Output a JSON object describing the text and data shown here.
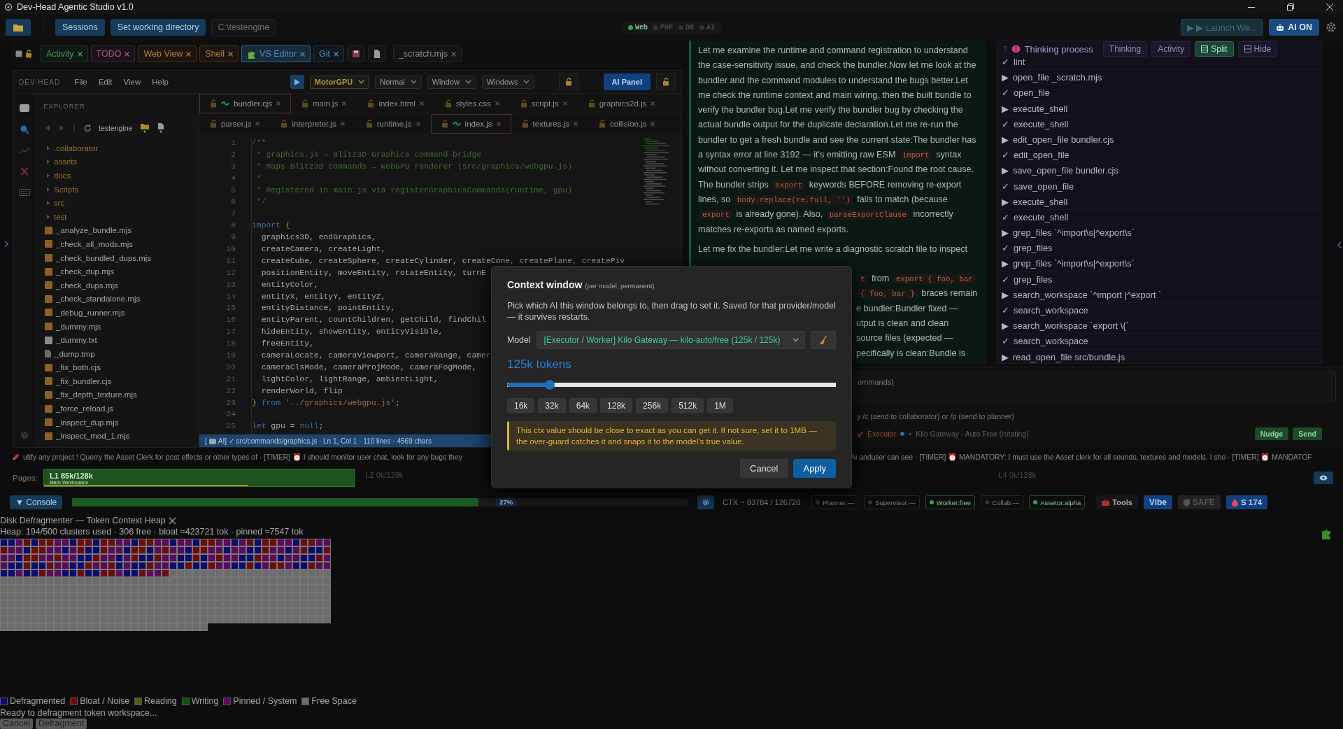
{
  "window": {
    "title": "Dev-Head Agentic Studio v1.0"
  },
  "toolbar": {
    "buttons": [
      "Sessions",
      "Set working directory"
    ],
    "path": "C:\\testengine",
    "services": [
      {
        "label": "Web",
        "on": true
      },
      {
        "label": "PHP",
        "on": false
      },
      {
        "label": "DB",
        "on": false
      },
      {
        "label": "AI",
        "on": false
      }
    ],
    "launch": "▶ ▶ Launch We...",
    "ai_toggle": {
      "label": "AI ON",
      "on": true
    }
  },
  "tab_strip": {
    "checked": false,
    "tabs": [
      {
        "label": "Activity",
        "color": "#3fa05a",
        "selected": false
      },
      {
        "label": "TODO",
        "color": "#b0508a",
        "selected": false
      },
      {
        "label": "Web View",
        "color": "#c07a30",
        "selected": false
      },
      {
        "label": "Shell",
        "color": "#c07a30",
        "selected": false
      },
      {
        "label": "VS Editor",
        "color": "#3f8fd0",
        "selected": true
      },
      {
        "label": "Git",
        "color": "#3f8fd0",
        "selected": false
      }
    ],
    "scratch": "_scratch.mjs"
  },
  "editor": {
    "brand": "DEV-HEAD",
    "menu": [
      "File",
      "Edit",
      "View",
      "Help"
    ],
    "selects": [
      {
        "value": "MotorGPU",
        "kind": "engine"
      },
      {
        "value": "Normal",
        "kind": "plain"
      },
      {
        "value": "Window",
        "kind": "plain"
      },
      {
        "value": "Windows",
        "kind": "plain"
      }
    ],
    "ai_panel": "AI Panel",
    "explorer": {
      "title": "EXPLORER",
      "root": "testengine",
      "items": [
        {
          "name": ".collaborator",
          "kind": "folder",
          "expanded": false
        },
        {
          "name": "assets",
          "kind": "folder",
          "expanded": false
        },
        {
          "name": "docs",
          "kind": "folder",
          "expanded": false
        },
        {
          "name": "Scripts",
          "kind": "folder",
          "expanded": false
        },
        {
          "name": "src",
          "kind": "folder",
          "expanded": false
        },
        {
          "name": "test",
          "kind": "folder",
          "expanded": false
        },
        {
          "name": "_analyze_bundle.mjs",
          "kind": "script"
        },
        {
          "name": "_check_all_mods.mjs",
          "kind": "script"
        },
        {
          "name": "_check_bundled_dups.mjs",
          "kind": "script"
        },
        {
          "name": "_check_dup.mjs",
          "kind": "script"
        },
        {
          "name": "_check_dups.mjs",
          "kind": "script"
        },
        {
          "name": "_check_standalone.mjs",
          "kind": "script"
        },
        {
          "name": "_debug_runner.mjs",
          "kind": "script"
        },
        {
          "name": "_dummy.mjs",
          "kind": "script"
        },
        {
          "name": "_dummy.txt",
          "kind": "text"
        },
        {
          "name": "_dump.tmp",
          "kind": "file"
        },
        {
          "name": "_fix_both.cjs",
          "kind": "script"
        },
        {
          "name": "_fix_bundler.cjs",
          "kind": "script"
        },
        {
          "name": "_fix_depth_texture.mjs",
          "kind": "script"
        },
        {
          "name": "_force_reload.js",
          "kind": "script"
        },
        {
          "name": "_inspect_dup.mjs",
          "kind": "script"
        },
        {
          "name": "_inspect_mod_1.mjs",
          "kind": "script"
        }
      ]
    },
    "file_tabs": [
      [
        {
          "name": "bundler.cjs",
          "modified": true
        },
        {
          "name": "main.js",
          "modified": false
        },
        {
          "name": "index.html",
          "modified": false
        },
        {
          "name": "styles.css",
          "modified": false
        },
        {
          "name": "script.js",
          "modified": false
        },
        {
          "name": "graphics2d.js",
          "modified": false
        }
      ],
      [
        {
          "name": "parser.js",
          "modified": false
        },
        {
          "name": "interpreter.js",
          "modified": false
        },
        {
          "name": "runtime.js",
          "modified": false
        },
        {
          "name": "index.js",
          "modified": true
        },
        {
          "name": "textures.js",
          "modified": false
        },
        {
          "name": "collision.js",
          "modified": false
        }
      ]
    ],
    "code_lines": [
      {
        "number": "1",
        "parts": [
          {
            "text": "/**",
            "kind": "comment"
          }
        ]
      },
      {
        "number": "2",
        "parts": [
          {
            "text": " * graphics.js — Blitz3D Graphics command bridge",
            "kind": "comment"
          }
        ]
      },
      {
        "number": "3",
        "parts": [
          {
            "text": " * Maps Blitz3D commands → WebGPU renderer (src/graphics/webgpu.js)",
            "kind": "comment"
          }
        ]
      },
      {
        "number": "4",
        "parts": [
          {
            "text": " *",
            "kind": "comment"
          }
        ]
      },
      {
        "number": "5",
        "parts": [
          {
            "text": " * Registered in main.js via registerGraphicsCommands(runtime, gpu)",
            "kind": "comment"
          }
        ]
      },
      {
        "number": "6",
        "parts": [
          {
            "text": " */",
            "kind": "comment"
          }
        ]
      },
      {
        "number": "7"
      },
      {
        "number": "8",
        "parts": [
          {
            "text": "import",
            "kind": "keyword"
          },
          {
            "text": " {",
            "kind": "brace"
          }
        ]
      },
      {
        "number": "9",
        "parts": [
          {
            "text": "  graphics3D, endGraphics,",
            "kind": "plain"
          }
        ]
      },
      {
        "number": "10",
        "parts": [
          {
            "text": "  createCamera, createLight,",
            "kind": "plain"
          }
        ]
      },
      {
        "number": "11",
        "parts": [
          {
            "text": "  createCube, createSphere, createCylinder, createCone, createPlane, createPiv",
            "kind": "plain"
          }
        ]
      },
      {
        "number": "12",
        "parts": [
          {
            "text": "  positionEntity, moveEntity, rotateEntity, turnE",
            "kind": "plain"
          }
        ]
      },
      {
        "number": "13",
        "parts": [
          {
            "text": "  entityColor,",
            "kind": "plain"
          }
        ]
      },
      {
        "number": "14",
        "parts": [
          {
            "text": "  entityX, entityY, entityZ,",
            "kind": "plain"
          }
        ]
      },
      {
        "number": "15",
        "parts": [
          {
            "text": "  entityDistance, pointEntity,",
            "kind": "plain"
          }
        ]
      },
      {
        "number": "16",
        "parts": [
          {
            "text": "  entityParent, countChildren, getChild, findChil",
            "kind": "plain"
          }
        ]
      },
      {
        "number": "17",
        "parts": [
          {
            "text": "  hideEntity, showEntity, entityVisible,",
            "kind": "plain"
          }
        ]
      },
      {
        "number": "18",
        "parts": [
          {
            "text": "  freeEntity,",
            "kind": "plain"
          }
        ]
      },
      {
        "number": "19",
        "parts": [
          {
            "text": "  cameraLocate, cameraViewport, cameraRange, camer",
            "kind": "plain"
          }
        ]
      },
      {
        "number": "20",
        "parts": [
          {
            "text": "  cameraClsMode, cameraProjMode, cameraFogMode,",
            "kind": "plain"
          }
        ]
      },
      {
        "number": "21",
        "parts": [
          {
            "text": "  lightColor, lightRange, ambientLight,",
            "kind": "plain"
          }
        ]
      },
      {
        "number": "22",
        "parts": [
          {
            "text": "  renderWorld, flip",
            "kind": "plain"
          }
        ]
      },
      {
        "number": "23",
        "parts": [
          {
            "text": "}",
            "kind": "brace"
          },
          {
            "text": " from ",
            "kind": "keyword"
          },
          {
            "text": "'../graphics/webgpu.js'",
            "kind": "string"
          },
          {
            "text": ";",
            "kind": "plain"
          }
        ]
      },
      {
        "number": "24"
      },
      {
        "number": "25",
        "parts": [
          {
            "text": "let",
            "kind": "keyword"
          },
          {
            "text": " gpu = ",
            "kind": "plain"
          },
          {
            "text": "null",
            "kind": "keyword"
          },
          {
            "text": ";",
            "kind": "plain"
          }
        ]
      }
    ],
    "status": {
      "prefix": "[",
      "text": "AI] ✓ src/commands/graphics.js · Ln 1, Col 1 · 110 lines · 4569 chars"
    }
  },
  "chat": {
    "paragraphs": [
      [
        {
          "text": "Let me examine the runtime and command registration to understand the case-sensitivity issue, and check the bundler.Now let me look at the bundler and the command modules to understand the bugs better.Let me check the runtime context and main wiring, then the built bundle to verify the bundler bug.Let me verify the bundler bug by checking the actual bundle output for the duplicate declaration.Let me re-run the bundler to get a fresh bundle and see the current state:The bundler has a syntax error at line 3192 — it's emitting raw ESM ",
          "kind": "text"
        },
        {
          "text": "import",
          "kind": "code"
        },
        {
          "text": " syntax without converting it. Let me inspect that section:Found the root cause. The bundler strips ",
          "kind": "text"
        },
        {
          "text": "export",
          "kind": "code"
        },
        {
          "text": " keywords BEFORE removing re-export lines, so ",
          "kind": "text"
        },
        {
          "text": "body.replace(re.full, '')",
          "kind": "code"
        },
        {
          "text": " fails to match (because ",
          "kind": "text"
        },
        {
          "text": "export",
          "kind": "code"
        },
        {
          "text": " is already gone). Also, ",
          "kind": "text"
        },
        {
          "text": "parseExportClause",
          "kind": "code"
        },
        {
          "text": " incorrectly matches re-exports as named exports.",
          "kind": "text"
        }
      ],
      [
        {
          "text": "Let me fix the bundler:Let me write a diagnostic scratch file to inspect",
          "kind": "text"
        }
      ]
    ],
    "fragments": [
      [
        {
          "text": "t",
          "kind": "code"
        },
        {
          "text": " from ",
          "kind": "text"
        },
        {
          "text": "export { foo, bar",
          "kind": "code"
        }
      ],
      [
        {
          "text": "{ foo, bar }",
          "kind": "code"
        },
        {
          "text": " braces remain",
          "kind": "text"
        }
      ],
      [
        {
          "text": "e bundler:Bundler fixed —",
          "kind": "text"
        }
      ],
      [
        {
          "text": "utput is clean and clean",
          "kind": "text"
        }
      ],
      [
        {
          "text": "source files (expected —",
          "kind": "text"
        }
      ],
      [
        {
          "text": "pecifically is clean:Bundle is",
          "kind": "text"
        }
      ]
    ]
  },
  "thinking": {
    "help": "?",
    "title": "Thinking process",
    "tabs": [
      {
        "label": "Thinking",
        "kind": "plain",
        "selected": false
      },
      {
        "label": "Activity",
        "kind": "plain",
        "selected": false
      },
      {
        "label": "Split",
        "kind": "split",
        "selected": true
      },
      {
        "label": "Hide",
        "kind": "hide",
        "selected": false
      }
    ],
    "items": [
      {
        "glyph": "✓",
        "text": "lint"
      },
      {
        "glyph": "▶",
        "text": "open_file _scratch.mjs"
      },
      {
        "glyph": "✓",
        "text": "open_file"
      },
      {
        "glyph": "▶",
        "text": "execute_shell"
      },
      {
        "glyph": "✓",
        "text": "execute_shell"
      },
      {
        "glyph": "▶",
        "text": "edit_open_file bundler.cjs"
      },
      {
        "glyph": "✓",
        "text": "edit_open_file"
      },
      {
        "glyph": "▶",
        "text": "save_open_file bundler.cjs"
      },
      {
        "glyph": "✓",
        "text": "save_open_file"
      },
      {
        "glyph": "▶",
        "text": "execute_shell"
      },
      {
        "glyph": "✓",
        "text": "execute_shell"
      },
      {
        "glyph": "▶",
        "text": "grep_files `^import\\s|^export\\s`"
      },
      {
        "glyph": "✓",
        "text": "grep_files"
      },
      {
        "glyph": "▶",
        "text": "grep_files `^import\\s|^export\\s`"
      },
      {
        "glyph": "✓",
        "text": "grep_files"
      },
      {
        "glyph": "▶",
        "text": "search_workspace `^import |^export `"
      },
      {
        "glyph": "✓",
        "text": "search_workspace"
      },
      {
        "glyph": "▶",
        "text": "search_workspace `export \\{`"
      },
      {
        "glyph": "✓",
        "text": "search_workspace"
      },
      {
        "glyph": "▶",
        "text": "read_open_file src/bundle.js"
      }
    ]
  },
  "chat_input": {
    "placeholder": "ommands)",
    "hint": "y /c (send to collaborator) or /p (send to planner)",
    "agent": "Executor",
    "separator": "•",
    "model": "Kilo Gateway - Auto Free (rotating)",
    "buttons": [
      "Nudge",
      "Send"
    ]
  },
  "ticker": [
    "utify any project ! Querry the Asset Clerk for post effects or other types of  ·  [TIMER] ⏰ I should monitor user chat, look for any bugs they",
    "Ai anduser can see  ·  [TIMER] ⏰ MANDATORY: I must use the Asset clerk for all sounds, textures and models. I sho  ·  [TIMER] ⏰ MANDATOF"
  ],
  "pages": {
    "label": "Pages:",
    "items": [
      {
        "label": "L1 85k/128k",
        "sub": "Main Workspace",
        "active": true,
        "level": 0.66
      },
      {
        "label": "L2 0k/128k",
        "active": false
      },
      {
        "label": "L4 0k/128k",
        "active": false
      }
    ]
  },
  "status_bar": {
    "console": "▼ Console",
    "progress": {
      "level": 0.66,
      "reading": "27%"
    },
    "ctx": "CTX ~  83784 / 126720",
    "agents": [
      {
        "label": "Planner:—",
        "on": false
      },
      {
        "label": "Supervisor:—",
        "on": false
      },
      {
        "label": "Worker:free",
        "on": true
      },
      {
        "label": "Collab:—",
        "on": false
      },
      {
        "label": "Assetor:alpha",
        "on": true
      }
    ],
    "buttons": [
      {
        "label": "Tools",
        "kind": "tools"
      },
      {
        "label": "Vibe",
        "kind": "vibe"
      },
      {
        "label": "SAFE",
        "kind": "safe"
      },
      {
        "label": "S 174",
        "kind": "score"
      }
    ]
  },
  "defrag": {
    "title": "Disk Defragmenter — Token Context Heap",
    "heap": "Heap: 194/500 clusters used · 306 free · bloat ≈423721 tok · pinned ≈7547 tok",
    "legend": [
      {
        "label": "Defragmented",
        "color": "#0c0c70"
      },
      {
        "label": "Bloat / Noise",
        "color": "#6e0c0c"
      },
      {
        "label": "Reading",
        "color": "#5a5a0c"
      },
      {
        "label": "Writing",
        "color": "#0c560c"
      },
      {
        "label": "Pinned / System",
        "color": "#5a0c5a"
      },
      {
        "label": "Free Space",
        "color": "#6c6c6c"
      }
    ],
    "message": "Ready to defragment token workspace...",
    "buttons": [
      "Cancel",
      "Defragment"
    ]
  },
  "dialog": {
    "title": "Context window",
    "note": "(per model, permanent)",
    "description": "Pick which AI this window belongs to, then drag to set it. Saved for that provider/model — it survives restarts.",
    "model_label": "Model",
    "model_value": "[Executor / Worker] Kilo Gateway — kilo-auto/free (125k / 125k)",
    "tokens": "125k tokens",
    "level": 0.13,
    "presets": [
      "16k",
      "32k",
      "64k",
      "128k",
      "256k",
      "512k",
      "1M"
    ],
    "warning": "This ctx value should be close to exact as you can get it. If not sure, set it to 1MB — the over-guard catches it and snaps it to the model's true value.",
    "buttons": [
      {
        "label": "Cancel",
        "primary": false
      },
      {
        "label": "Apply",
        "primary": true
      }
    ]
  }
}
